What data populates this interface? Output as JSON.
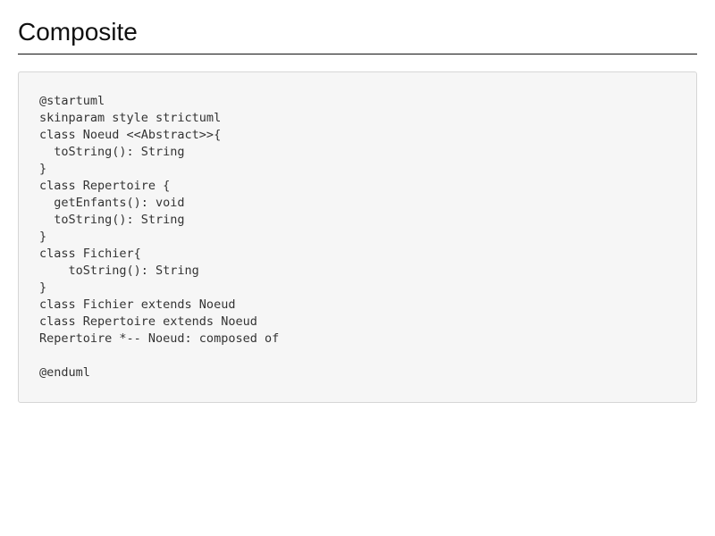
{
  "page": {
    "title": "Composite"
  },
  "code_block": {
    "lines": [
      "@startuml",
      "skinparam style strictuml",
      "class Noeud <<Abstract>>{",
      "  toString(): String",
      "}",
      "class Repertoire {",
      "  getEnfants(): void",
      "  toString(): String",
      "}",
      "class Fichier{",
      "    toString(): String",
      "}",
      "class Fichier extends Noeud",
      "class Repertoire extends Noeud",
      "Repertoire *-- Noeud: composed of",
      "",
      "@enduml"
    ]
  }
}
